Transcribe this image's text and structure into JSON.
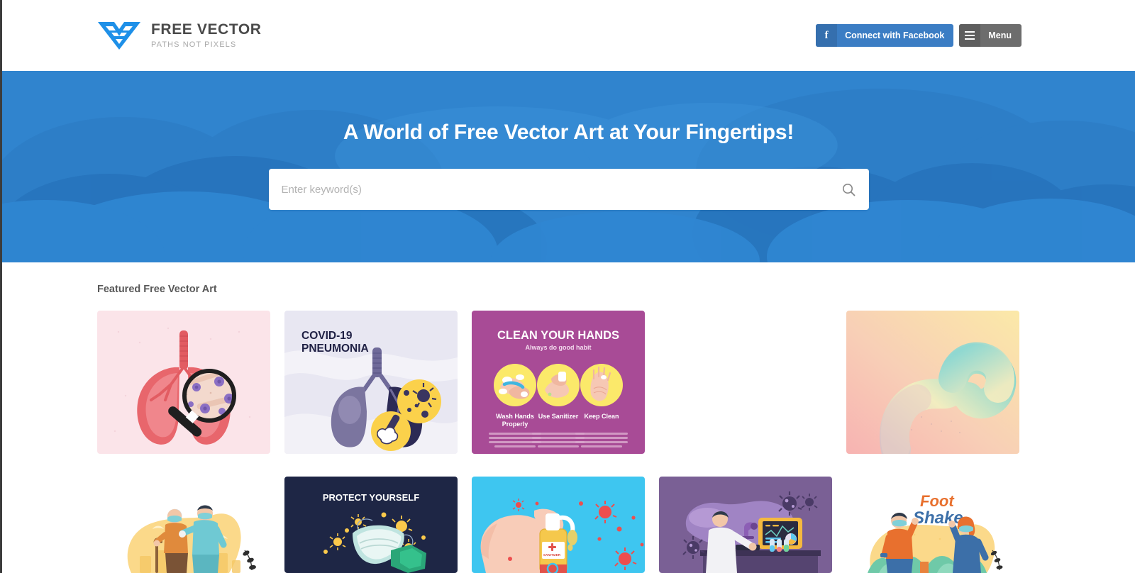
{
  "header": {
    "brand": {
      "name": "FREE VECTOR",
      "tagline": "PATHS NOT PIXELS",
      "logo_icon": "free-vector-logo-icon",
      "logo_color": "#1e90e8"
    },
    "facebook_button": {
      "label": "Connect with Facebook",
      "icon": "facebook-f-icon",
      "bg_color": "#3b7dc4"
    },
    "menu_button": {
      "label": "Menu",
      "icon": "hamburger-menu-icon",
      "bg_color": "#6d6d6d"
    }
  },
  "hero": {
    "title": "A World of Free Vector Art at Your Fingertips!",
    "bg_color": "#3084ce",
    "search": {
      "placeholder": "Enter keyword(s)",
      "value": "",
      "icon": "search-icon"
    }
  },
  "featured": {
    "title": "Featured Free Vector Art",
    "items": [
      {
        "id": "lungs-magnifier",
        "alt": "Lungs with magnifying glass showing virus",
        "bg": "#fbe4e9",
        "row": 1
      },
      {
        "id": "covid-pneumonia",
        "alt": "COVID-19 Pneumonia lungs illustration",
        "bg": "#e8e7f2",
        "caption_line1": "COVID-19",
        "caption_line2": "PNEUMONIA",
        "caption_color": "#1f2044",
        "row": 1
      },
      {
        "id": "clean-your-hands",
        "alt": "Clean your hands infographic poster",
        "bg": "#a84b96",
        "title": "CLEAN YOUR HANDS",
        "subtitle": "Always do good habit",
        "steps": [
          "Wash Hands Properly",
          "Use Sanitizer",
          "Keep Clean"
        ],
        "row": 1
      },
      {
        "id": "empty-slot",
        "alt": "",
        "bg": "#ffffff",
        "row": 1
      },
      {
        "id": "abstract-gradient-blob",
        "alt": "Abstract pastel gradient fluid shape",
        "bg": "#f7c9c6",
        "row": 1
      },
      {
        "id": "elderly-care",
        "alt": "Caregiver helping elderly person with masks",
        "bg": "#ffffff",
        "row": 2
      },
      {
        "id": "protect-yourself",
        "alt": "Protect yourself face mask illustration",
        "bg": "#1e2645",
        "title": "PROTECT YOURSELF",
        "row": 2
      },
      {
        "id": "hand-sanitizer",
        "alt": "Hand holding sanitizer bottle with viruses",
        "bg": "#3ec6f0",
        "row": 2
      },
      {
        "id": "lab-scientist",
        "alt": "Scientist working in laboratory with microscope",
        "bg": "#7a6095",
        "row": 2
      },
      {
        "id": "foot-shake",
        "alt": "Foot shake greeting illustration",
        "bg": "#ffffff",
        "title_part1": "Foot",
        "title_part2": "Shake",
        "row": 2
      }
    ]
  }
}
